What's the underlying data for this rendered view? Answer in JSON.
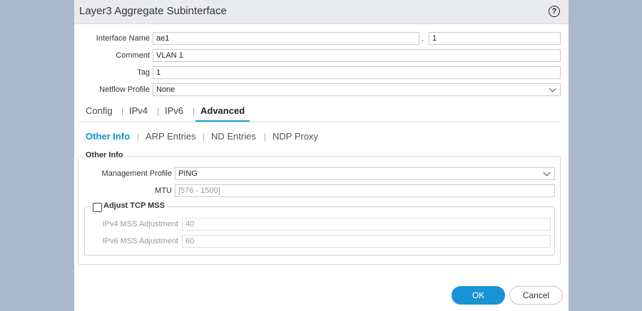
{
  "dialog": {
    "title": "Layer3 Aggregate Subinterface",
    "help_icon": "?"
  },
  "form": {
    "interface_name_label": "Interface Name",
    "interface_name_value": "ae1",
    "dot": ".",
    "subinterface_value": "1",
    "comment_label": "Comment",
    "comment_value": "VLAN 1",
    "tag_label": "Tag",
    "tag_value": "1",
    "netflow_label": "Netflow Profile",
    "netflow_value": "None"
  },
  "tabs": [
    "Config",
    "IPv4",
    "IPv6",
    "Advanced"
  ],
  "subtabs": [
    "Other Info",
    "ARP Entries",
    "ND Entries",
    "NDP Proxy"
  ],
  "other_info": {
    "title": "Other Info",
    "mgmt_profile_label": "Management Profile",
    "mgmt_profile_value": "PING",
    "mtu_label": "MTU",
    "mtu_placeholder": "[576 - 1500]",
    "adjust_tcp_mss_label": "Adjust TCP MSS",
    "ipv4_mss_label": "IPv4 MSS Adjustment",
    "ipv4_mss_value": "40",
    "ipv6_mss_label": "IPv6 MSS Adjustment",
    "ipv6_mss_value": "60"
  },
  "buttons": {
    "ok": "OK",
    "cancel": "Cancel"
  },
  "colors": {
    "accent": "#1893d5",
    "backdrop": "#a9b8cb"
  }
}
